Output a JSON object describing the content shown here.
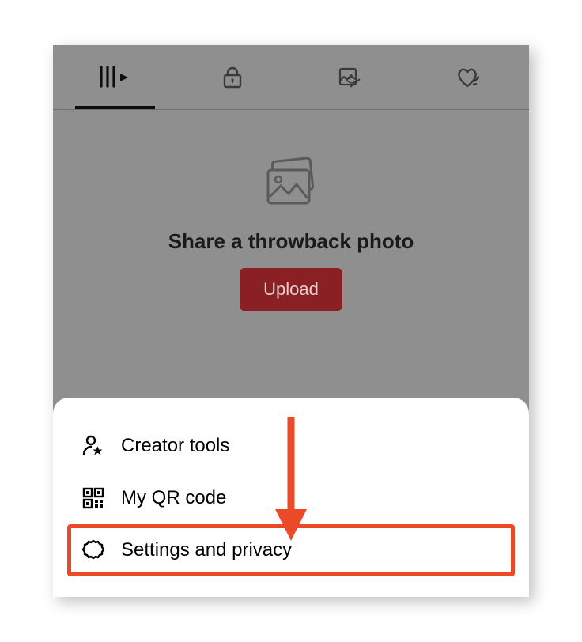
{
  "tabs": {
    "feed": "feed",
    "lock": "lock",
    "hiddenPhoto": "hidden-photo",
    "brokenHeart": "broken-heart"
  },
  "emptyState": {
    "title": "Share a throwback photo",
    "uploadLabel": "Upload"
  },
  "menu": {
    "creatorTools": "Creator tools",
    "myQrCode": "My QR code",
    "settingsPrivacy": "Settings and privacy"
  },
  "annotation": {
    "highlightColor": "#eb4a26"
  }
}
